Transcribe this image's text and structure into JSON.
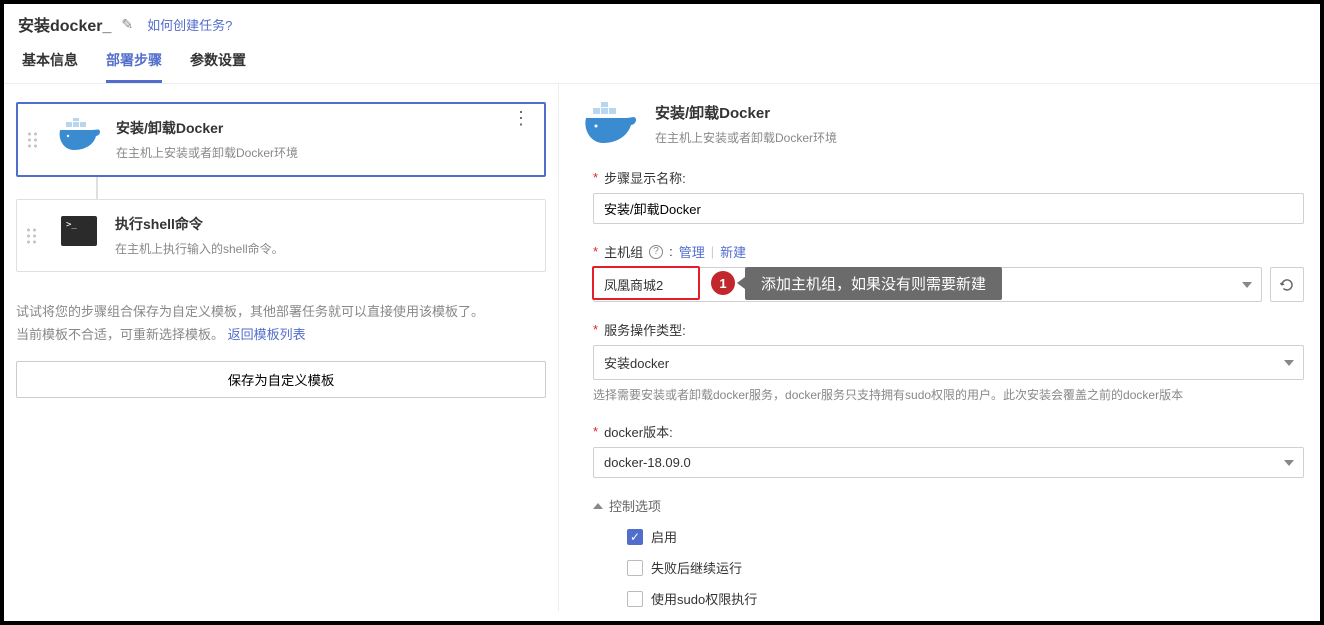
{
  "header": {
    "title": "安装docker_",
    "help_link": "如何创建任务?"
  },
  "tabs": {
    "basic": "基本信息",
    "steps": "部署步骤",
    "params": "参数设置"
  },
  "steps": [
    {
      "title": "安装/卸载Docker",
      "desc": "在主机上安装或者卸载Docker环境"
    },
    {
      "title": "执行shell命令",
      "desc": "在主机上执行输入的shell命令。"
    }
  ],
  "left_panel": {
    "hint1": "试试将您的步骤组合保存为自定义模板，其他部署任务就可以直接使用该模板了。",
    "hint2_prefix": "当前模板不合适，可重新选择模板。",
    "hint2_link": "返回模板列表",
    "save_button": "保存为自定义模板"
  },
  "right_header": {
    "title": "安装/卸载Docker",
    "desc": "在主机上安装或者卸载Docker环境"
  },
  "form": {
    "step_name_label": "步骤显示名称:",
    "step_name_value": "安装/卸载Docker",
    "host_group_label": "主机组",
    "host_group_manage": "管理",
    "host_group_new": "新建",
    "host_group_value": "凤凰商城2",
    "callout_number": "1",
    "callout_text": "添加主机组，如果没有则需要新建",
    "service_type_label": "服务操作类型:",
    "service_type_value": "安装docker",
    "service_type_hint": "选择需要安装或者卸载docker服务，docker服务只支持拥有sudo权限的用户。此次安装会覆盖之前的docker版本",
    "docker_version_label": "docker版本:",
    "docker_version_value": "docker-18.09.0",
    "ctrl_title": "控制选项",
    "ctrl_enable": "启用",
    "ctrl_continue": "失败后继续运行",
    "ctrl_sudo": "使用sudo权限执行"
  },
  "colors": {
    "accent": "#526ecc",
    "danger": "#e41f2b"
  }
}
